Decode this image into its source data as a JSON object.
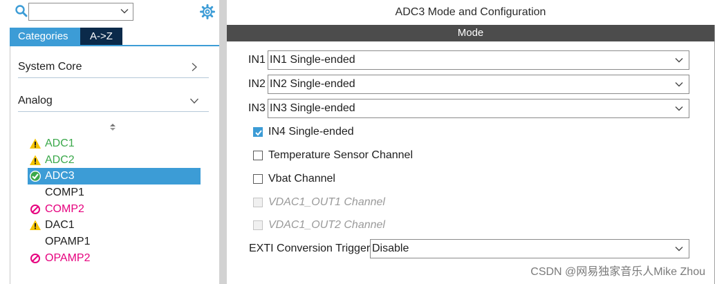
{
  "sidebar": {
    "search": {
      "value": ""
    },
    "tabs": [
      {
        "label": "Categories",
        "active": true
      },
      {
        "label": "A->Z",
        "active": false
      }
    ],
    "categories": [
      {
        "label": "System Core",
        "expanded": false
      },
      {
        "label": "Analog",
        "expanded": true
      }
    ],
    "peripherals": [
      {
        "label": "ADC1",
        "status": "warning",
        "color": "#3aa84a"
      },
      {
        "label": "ADC2",
        "status": "warning",
        "color": "#3aa84a"
      },
      {
        "label": "ADC3",
        "status": "ok",
        "selected": true,
        "color": "#ffffff"
      },
      {
        "label": "COMP1",
        "status": "none",
        "color": "#1e1e1e"
      },
      {
        "label": "COMP2",
        "status": "blocked",
        "color": "#e6007e"
      },
      {
        "label": "DAC1",
        "status": "warning",
        "color": "#1e1e1e"
      },
      {
        "label": "OPAMP1",
        "status": "none",
        "color": "#1e1e1e"
      },
      {
        "label": "OPAMP2",
        "status": "blocked",
        "color": "#e6007e"
      }
    ]
  },
  "main": {
    "title": "ADC3 Mode and Configuration",
    "section": "Mode",
    "inputs": [
      {
        "label": "IN1",
        "value": "IN1 Single-ended"
      },
      {
        "label": "IN2",
        "value": "IN2 Single-ended"
      },
      {
        "label": "IN3",
        "value": "IN3 Single-ended"
      }
    ],
    "checkboxes": [
      {
        "label": "IN4 Single-ended",
        "checked": true,
        "disabled": false
      },
      {
        "label": "Temperature Sensor Channel",
        "checked": false,
        "disabled": false
      },
      {
        "label": "Vbat Channel",
        "checked": false,
        "disabled": false
      },
      {
        "label": "VDAC1_OUT1 Channel",
        "checked": false,
        "disabled": true
      },
      {
        "label": "VDAC1_OUT2 Channel",
        "checked": false,
        "disabled": true
      }
    ],
    "exti": {
      "label": "EXTI Conversion Trigger",
      "value": "Disable"
    }
  },
  "watermark": "CSDN @网易独家音乐人Mike Zhou",
  "colors": {
    "accent": "#3c9cd6",
    "tab_dark": "#0b2a4a",
    "mode_bar": "#4c4c4c",
    "warning": "#f5c400",
    "blocked": "#e6007e",
    "ok": "#3aa84a"
  }
}
